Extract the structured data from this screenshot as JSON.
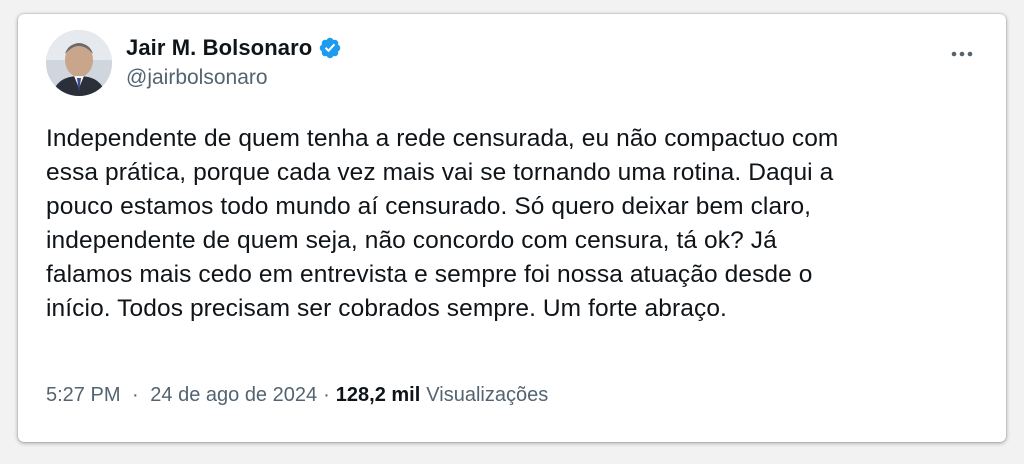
{
  "author": {
    "name": "Jair M. Bolsonaro",
    "handle": "@jairbolsonaro",
    "verified": true,
    "avatar_icon": "profile-photo",
    "verified_icon": "verified-badge-icon",
    "verified_color": "#1d9bf0"
  },
  "menu": {
    "icon": "more-options-icon"
  },
  "tweet": {
    "lines": [
      "Independente de quem tenha a rede censurada, eu não compactuo com",
      "essa prática, porque cada vez mais vai se tornando uma rotina. Daqui a",
      "pouco estamos todo mundo aí censurado. Só quero deixar bem claro,",
      "independente de quem seja, não concordo com censura, tá ok? Já",
      "falamos mais cedo em entrevista e sempre foi nossa atuação desde o",
      "início. Todos precisam ser cobrados sempre. Um forte abraço."
    ]
  },
  "meta": {
    "time": "5:27 PM",
    "separator": "·",
    "date": "24 de ago de 2024",
    "views_count": "128,2 mil",
    "views_label": "Visualizações"
  },
  "colors": {
    "text": "#0f1419",
    "secondary": "#536471",
    "background": "#ffffff"
  }
}
